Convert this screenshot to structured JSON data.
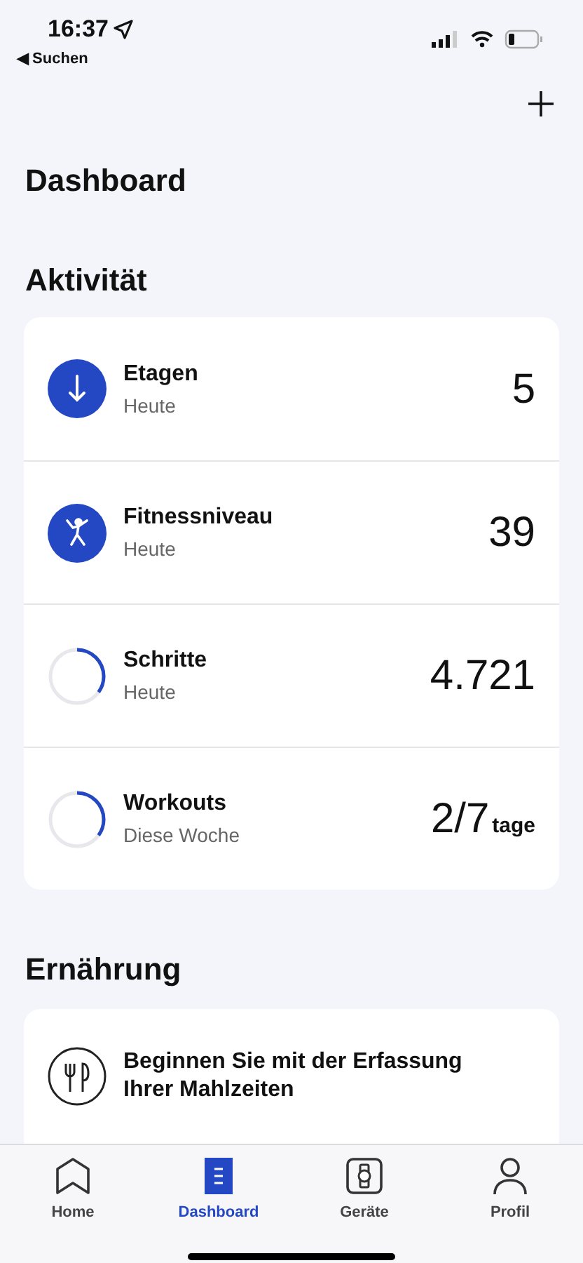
{
  "status_bar": {
    "time": "16:37",
    "back_label": "◀ Suchen"
  },
  "page_title": "Dashboard",
  "activity": {
    "heading": "Aktivität",
    "rows": [
      {
        "kind": "arrow",
        "title": "Etagen",
        "subtitle": "Heute",
        "value": "5"
      },
      {
        "kind": "figure",
        "title": "Fitnessniveau",
        "subtitle": "Heute",
        "value": "39"
      },
      {
        "kind": "ring",
        "title": "Schritte",
        "subtitle": "Heute",
        "value": "4.721"
      },
      {
        "kind": "ring",
        "title": "Workouts",
        "subtitle": "Diese Woche",
        "value": "2/7",
        "unit": "tage"
      }
    ]
  },
  "nutrition": {
    "heading": "Ernährung",
    "prompt": "Beginnen Sie mit der Erfassung Ihrer Mahlzeiten"
  },
  "tab_bar": [
    {
      "kind": "home",
      "label": "Home",
      "selected": false
    },
    {
      "kind": "dashboard",
      "label": "Dashboard",
      "selected": true
    },
    {
      "kind": "devices",
      "label": "Geräte",
      "selected": false
    },
    {
      "kind": "profile",
      "label": "Profil",
      "selected": false
    }
  ]
}
